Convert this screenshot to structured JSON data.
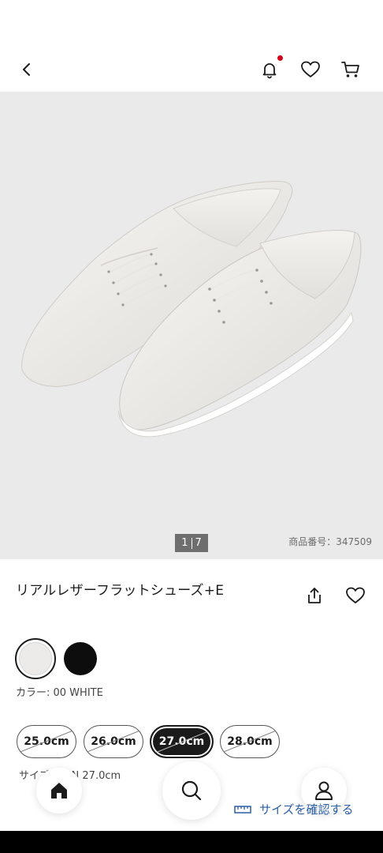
{
  "header": {
    "back_icon": "chevron-left-icon",
    "notification_icon": "bell-icon",
    "favorite_icon": "heart-icon",
    "cart_icon": "cart-icon",
    "notification_dot_color": "#d0021b"
  },
  "gallery": {
    "current": "1",
    "total": "7",
    "item_code": "商品番号：347509"
  },
  "product": {
    "title": "リアルレザーフラットシューズ+E",
    "share_icon": "share-icon",
    "favorite_icon": "heart-icon"
  },
  "colors": {
    "options": [
      {
        "name": "WHITE",
        "hex": "#ecebea",
        "selected": true
      },
      {
        "name": "BLACK",
        "hex": "#0d0d0d",
        "selected": false
      }
    ],
    "label": "カラー: 00 WHITE"
  },
  "sizes": {
    "options": [
      {
        "label": "25.0cm",
        "selected": false,
        "available": false
      },
      {
        "label": "26.0cm",
        "selected": false,
        "available": false
      },
      {
        "label": "27.0cm",
        "selected": true,
        "available": false
      },
      {
        "label": "28.0cm",
        "selected": false,
        "available": false
      }
    ],
    "label": "サイズ: MEN 27.0cm"
  },
  "size_check": {
    "label": "サイズを確認する",
    "icon": "ruler-icon",
    "color": "#2c5fa8"
  },
  "bottom_nav": {
    "home_icon": "home-icon",
    "search_icon": "search-icon",
    "account_icon": "account-icon"
  }
}
